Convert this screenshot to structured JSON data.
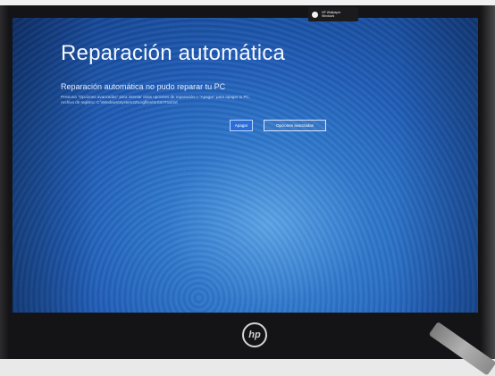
{
  "notification": {
    "lines": [
      "HP Wallpaper",
      "Windows"
    ]
  },
  "screen": {
    "title": "Reparación automática",
    "subtitle": "Reparación automática no pudo reparar tu PC",
    "description_lines": [
      "Presiona \"Opciones avanzadas\" para intentar otras opciones de reparación o \"Apagar\" para apagar tu PC.",
      "Archivo de registro: C:\\Windows\\System32\\Logfiles\\Srt\\SrtTrail.txt"
    ],
    "buttons": {
      "primary": "Apagar",
      "secondary": "Opciones avanzadas"
    }
  },
  "branding": {
    "logo_text": "hp"
  },
  "colors": {
    "screen_blue": "#1f5cb6",
    "bezel": "#141416",
    "button_primary": "#2a6edb"
  }
}
